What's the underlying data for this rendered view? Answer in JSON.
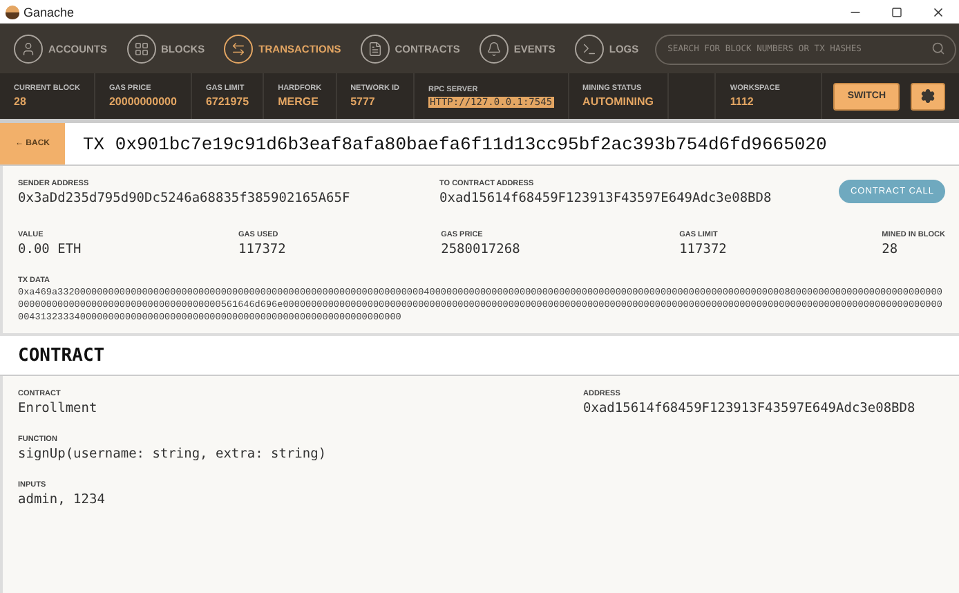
{
  "window": {
    "title": "Ganache"
  },
  "nav": {
    "items": [
      {
        "label": "ACCOUNTS",
        "selected": false
      },
      {
        "label": "BLOCKS",
        "selected": false
      },
      {
        "label": "TRANSACTIONS",
        "selected": true
      },
      {
        "label": "CONTRACTS",
        "selected": false
      },
      {
        "label": "EVENTS",
        "selected": false
      },
      {
        "label": "LOGS",
        "selected": false
      }
    ],
    "search": {
      "placeholder": "SEARCH FOR BLOCK NUMBERS OR TX HASHES"
    }
  },
  "stats": [
    {
      "label": "CURRENT BLOCK",
      "value": "28",
      "highlighted": false
    },
    {
      "label": "GAS PRICE",
      "value": "20000000000",
      "highlighted": false
    },
    {
      "label": "GAS LIMIT",
      "value": "6721975",
      "highlighted": false
    },
    {
      "label": "HARDFORK",
      "value": "MERGE",
      "highlighted": false
    },
    {
      "label": "NETWORK ID",
      "value": "5777",
      "highlighted": false
    },
    {
      "label": "RPC SERVER",
      "value": "HTTP://127.0.0.1:7545",
      "highlighted": true
    },
    {
      "label": "MINING STATUS",
      "value": "AUTOMINING",
      "highlighted": false
    }
  ],
  "workspace": {
    "label": "WORKSPACE",
    "value": "1112",
    "button": "SWITCH"
  },
  "back_button": "← BACK",
  "tx_title": "TX 0x901bc7e19c91d6b3eaf8afa80baefa6f11d13cc95bf2ac393b754d6fd9665020",
  "sender": {
    "label": "SENDER ADDRESS",
    "value": "0x3aDd235d795d90Dc5246a68835f385902165A65F"
  },
  "recipient": {
    "label": "TO CONTRACT ADDRESS",
    "value": "0xad15614f68459F123913F43597E649Adc3e08BD8"
  },
  "tx_type_badge": "CONTRACT CALL",
  "metrics": [
    {
      "label": "VALUE",
      "value": "0.00 ETH"
    },
    {
      "label": "GAS USED",
      "value": "117372"
    },
    {
      "label": "GAS PRICE",
      "value": "2580017268"
    },
    {
      "label": "GAS LIMIT",
      "value": "117372"
    },
    {
      "label": "MINED IN BLOCK",
      "value": "28"
    }
  ],
  "tx_data": {
    "label": "TX DATA",
    "value": "0xa469a3320000000000000000000000000000000000000000000000000000000000000040000000000000000000000000000000000000000000000000000000000000008000000000000000000000000000000000000000000000000000000000000000561646d696e00000000000000000000000000000000000000000000000000000000000000000000000000000000000000000000000000000000000000000000000431323334000000000000000000000000000000000000000000000000000000000"
  },
  "contract_section": {
    "heading": "CONTRACT",
    "contract": {
      "label": "CONTRACT",
      "value": "Enrollment"
    },
    "address": {
      "label": "ADDRESS",
      "value": "0xad15614f68459F123913F43597E649Adc3e08BD8"
    },
    "function": {
      "label": "FUNCTION",
      "value": "signUp(username: string, extra: string)"
    },
    "inputs": {
      "label": "INPUTS",
      "value": "admin, 1234"
    }
  }
}
